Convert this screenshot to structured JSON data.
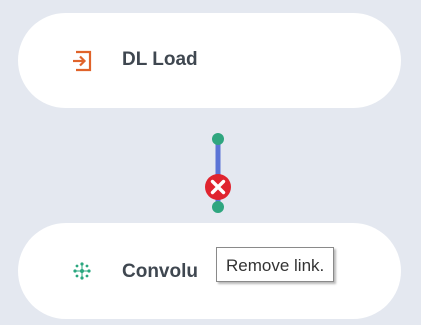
{
  "nodes": {
    "top": {
      "label": "DL Load",
      "icon": "import-arrow-icon",
      "icon_color": "#e0632a"
    },
    "bottom": {
      "label": "Convolu",
      "icon": "convolution-icon",
      "icon_color": "#2aa77f"
    }
  },
  "link": {
    "line_color": "#5b74d6",
    "endpoint_color": "#2fa67f",
    "remove_icon": "close-circle-icon",
    "remove_color": "#e0242f"
  },
  "tooltip": {
    "text": "Remove link."
  },
  "colors": {
    "canvas_bg": "#e4e8f0",
    "node_bg": "#ffffff"
  }
}
